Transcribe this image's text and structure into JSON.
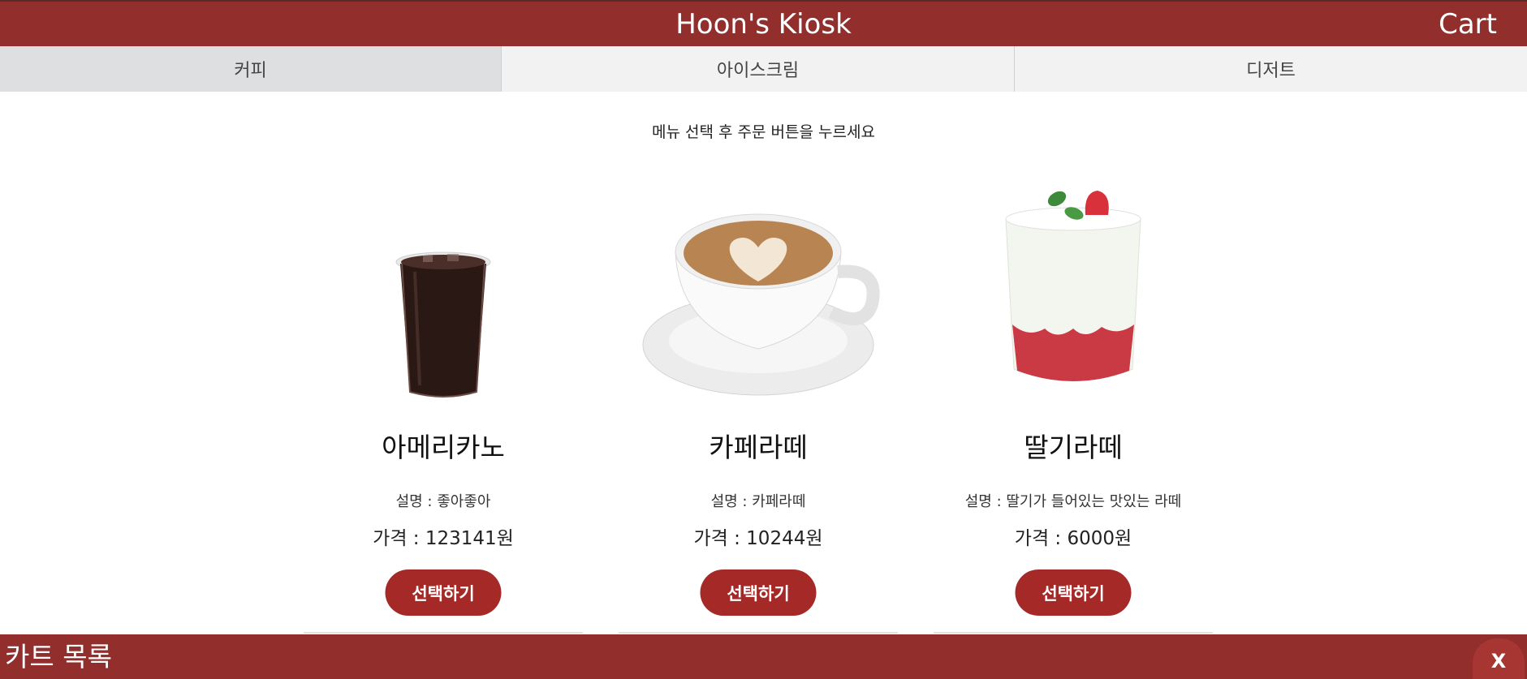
{
  "header": {
    "title": "Hoon's Kiosk",
    "cart_label": "Cart"
  },
  "tabs": [
    {
      "label": "커피",
      "active": true
    },
    {
      "label": "아이스크림",
      "active": false
    },
    {
      "label": "디저트",
      "active": false
    }
  ],
  "instruction": "메뉴 선택 후 주문 버튼을 누르세요",
  "menu": [
    {
      "name": "아메리카노",
      "desc": "설명 : 좋아좋아",
      "price": "가격 : 123141원",
      "button": "선택하기",
      "image": "iced-americano-image"
    },
    {
      "name": "카페라떼",
      "desc": "설명 : 카페라떼",
      "price": "가격 : 10244원",
      "button": "선택하기",
      "image": "cafe-latte-image"
    },
    {
      "name": "딸기라떼",
      "desc": "설명 : 딸기가 들어있는 맛있는 라떼",
      "price": "가격 : 6000원",
      "button": "선택하기",
      "image": "strawberry-latte-image"
    }
  ],
  "cart_bar": {
    "title": "카트 목록",
    "close_label": "X"
  },
  "colors": {
    "brand": "#922f2c",
    "button": "#a52a27",
    "active_tab": "#dedfe0",
    "tab": "#f2f2f2"
  }
}
